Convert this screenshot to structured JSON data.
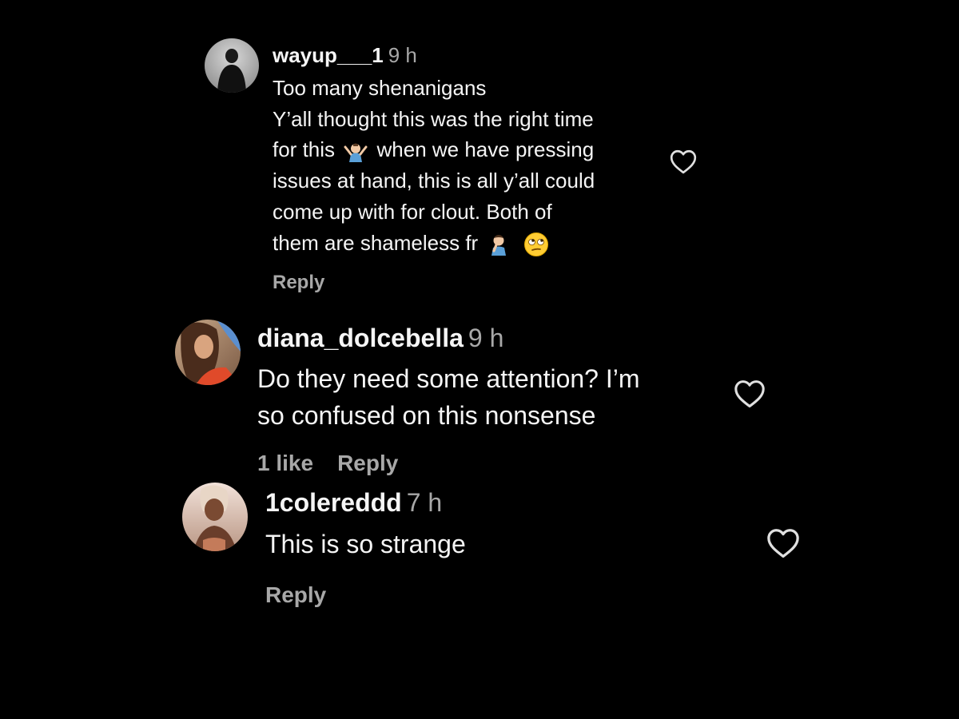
{
  "comments": [
    {
      "username": "wayup___1",
      "time": "9 h",
      "lines": [
        "Too many shenanigans",
        "Y’all thought this was the right time",
        "for this",
        "when we have pressing",
        "issues at hand, this is all y’all could",
        "come up with for clout. Both of",
        "them are shameless fr"
      ],
      "emojis": [
        "person-shrugging-emoji",
        "person-facepalming-emoji",
        "face-with-rolling-eyes-emoji"
      ],
      "reply_label": "Reply"
    },
    {
      "username": "diana_dolcebella",
      "time": "9 h",
      "lines": [
        "Do they need some attention? I’m",
        "so confused on this nonsense"
      ],
      "likes_label": "1 like",
      "reply_label": "Reply"
    },
    {
      "username": "1colereddd",
      "time": "7 h",
      "lines": [
        "This is so strange"
      ],
      "reply_label": "Reply"
    }
  ],
  "icons": {
    "like": "heart-outline-icon"
  },
  "colors": {
    "background": "#000000",
    "primary_text": "#f5f5f5",
    "secondary_text": "#a8a8a8"
  }
}
